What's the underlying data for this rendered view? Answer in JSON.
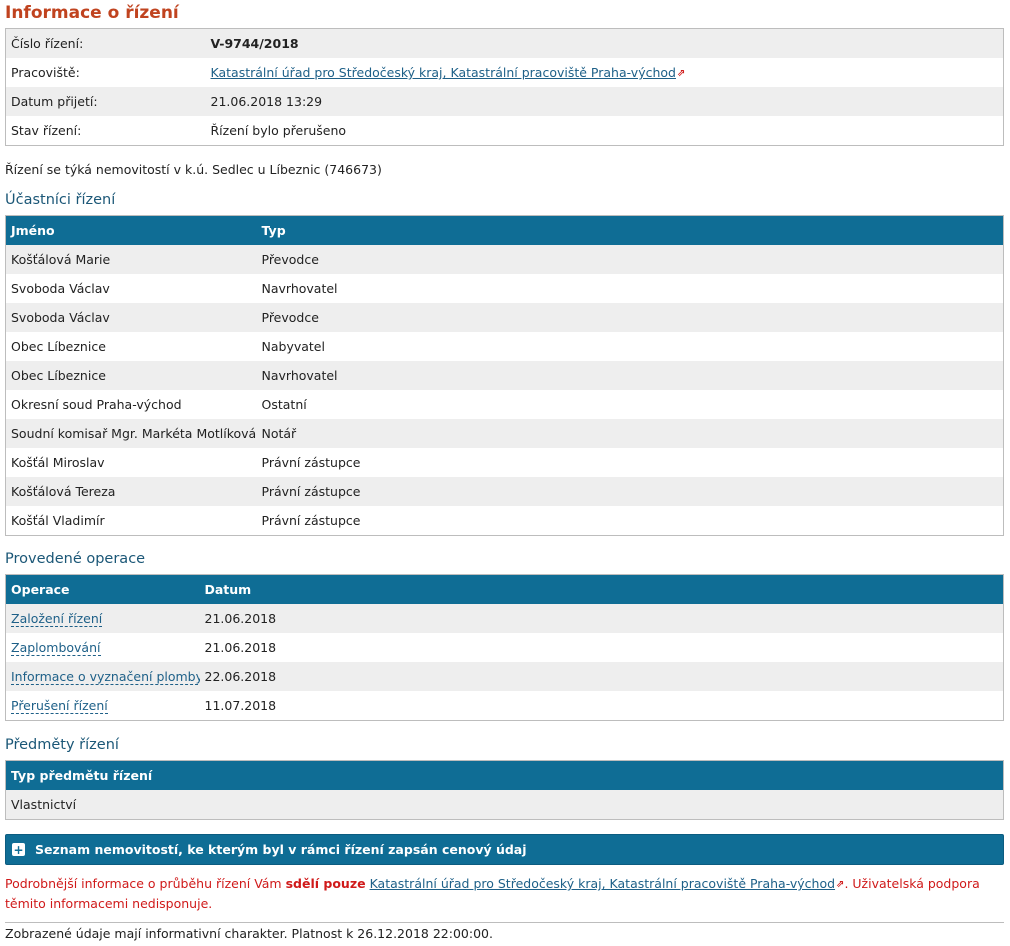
{
  "page": {
    "title": "Informace o řízení"
  },
  "info": {
    "rows": [
      {
        "label": "Číslo řízení:",
        "value": "V-9744/2018"
      },
      {
        "label": "Pracoviště:",
        "value": "Katastrální úřad pro Středočeský kraj, Katastrální pracoviště Praha-východ"
      },
      {
        "label": "Datum přijetí:",
        "value": "21.06.2018 13:29"
      },
      {
        "label": "Stav řízení:",
        "value": "Řízení bylo přerušeno"
      }
    ]
  },
  "note": "Řízení se týká nemovitostí v k.ú. Sedlec u Líbeznic (746673)",
  "participants": {
    "heading": "Účastníci řízení",
    "columns": [
      "Jméno",
      "Typ"
    ],
    "rows": [
      {
        "name": "Košťálová Marie",
        "type": "Převodce"
      },
      {
        "name": "Svoboda Václav",
        "type": "Navrhovatel"
      },
      {
        "name": "Svoboda Václav",
        "type": "Převodce"
      },
      {
        "name": "Obec Líbeznice",
        "type": "Nabyvatel"
      },
      {
        "name": "Obec Líbeznice",
        "type": "Navrhovatel"
      },
      {
        "name": "Okresní soud Praha-východ",
        "type": "Ostatní"
      },
      {
        "name": "Soudní komisař Mgr. Markéta Motlíková",
        "type": "Notář"
      },
      {
        "name": "Košťál Miroslav",
        "type": "Právní zástupce"
      },
      {
        "name": "Košťálová Tereza",
        "type": "Právní zástupce"
      },
      {
        "name": "Košťál Vladimír",
        "type": "Právní zástupce"
      }
    ]
  },
  "operations": {
    "heading": "Provedené operace",
    "columns": [
      "Operace",
      "Datum"
    ],
    "rows": [
      {
        "op": "Založení řízení",
        "date": "21.06.2018"
      },
      {
        "op": "Zaplombování",
        "date": "21.06.2018"
      },
      {
        "op": "Informace o vyznačení plomby",
        "date": "22.06.2018"
      },
      {
        "op": "Přerušení řízení",
        "date": "11.07.2018"
      }
    ]
  },
  "subjects": {
    "heading": "Předměty řízení",
    "column": "Typ předmětu řízení",
    "rows": [
      "Vlastnictví"
    ]
  },
  "collapsible": {
    "label": "Seznam nemovitostí, ke kterým byl v rámci řízení zapsán cenový údaj",
    "icon": "plus-icon"
  },
  "warning": {
    "part1": "Podrobnější informace o průběhu řízení Vám ",
    "bold": "sdělí pouze",
    "link": "Katastrální úřad pro Středočeský kraj, Katastrální pracoviště Praha-východ",
    "part2": ". Uživatelská podpora těmito informacemi nedisponuje."
  },
  "footer": "Zobrazené údaje mají informativní charakter. Platnost k 26.12.2018 22:00:00.",
  "colors": {
    "title": "#c0431f",
    "header_bg": "#0f6d95",
    "link": "#1e6088",
    "warning": "#d01a1a",
    "section_heading": "#1b5777"
  }
}
